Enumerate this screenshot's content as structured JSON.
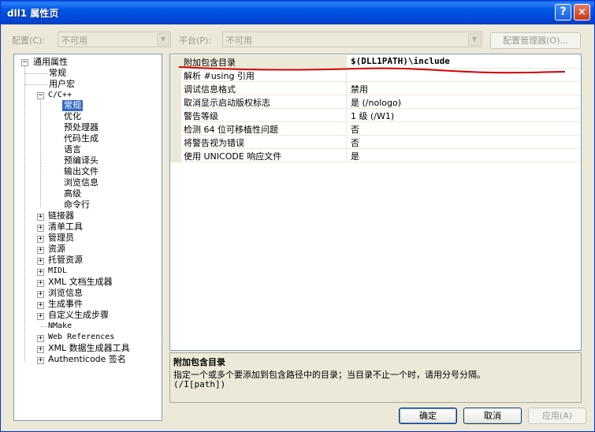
{
  "window": {
    "title": "dll1 属性页",
    "help_label": "?",
    "close_label": "×"
  },
  "config_bar": {
    "config_label": "配置(C):",
    "config_value": "不可用",
    "platform_label": "平台(P):",
    "platform_value": "不可用",
    "manager_label": "配置管理器(O)..."
  },
  "tree": {
    "root": "通用属性",
    "root_expander": "−",
    "items": [
      {
        "label": "常规"
      },
      {
        "label": "用户宏"
      },
      {
        "label": "C/C++",
        "expander": "−"
      },
      {
        "label": "常规",
        "selected": true
      },
      {
        "label": "优化"
      },
      {
        "label": "预处理器"
      },
      {
        "label": "代码生成"
      },
      {
        "label": "语言"
      },
      {
        "label": "预编译头"
      },
      {
        "label": "输出文件"
      },
      {
        "label": "浏览信息"
      },
      {
        "label": "高级"
      },
      {
        "label": "命令行"
      },
      {
        "label": "链接器",
        "expander": "+"
      },
      {
        "label": "清单工具",
        "expander": "+"
      },
      {
        "label": "管理员",
        "expander": "+"
      },
      {
        "label": "资源",
        "expander": "+"
      },
      {
        "label": "托管资源",
        "expander": "+"
      },
      {
        "label": "MIDL",
        "expander": "+"
      },
      {
        "label": "XML 文档生成器",
        "expander": "+"
      },
      {
        "label": "浏览信息",
        "expander": "+"
      },
      {
        "label": "生成事件",
        "expander": "+"
      },
      {
        "label": "自定义生成步骤",
        "expander": "+"
      },
      {
        "label": "NMake"
      },
      {
        "label": "Web References",
        "expander": "+"
      },
      {
        "label": "XML 数据生成器工具",
        "expander": "+"
      },
      {
        "label": "Authenticode 签名",
        "expander": "+"
      }
    ]
  },
  "grid": {
    "rows": [
      {
        "name": "附加包含目录",
        "value": "$(DLL1PATH)\\include"
      },
      {
        "name": "解析 #using 引用",
        "value": ""
      },
      {
        "name": "调试信息格式",
        "value": "禁用"
      },
      {
        "name": "取消显示启动版权标志",
        "value": "是 (/nologo)"
      },
      {
        "name": "警告等级",
        "value": "1 级 (/W1)"
      },
      {
        "name": "检测 64 位可移植性问题",
        "value": "否"
      },
      {
        "name": "将警告视为错误",
        "value": "否"
      },
      {
        "name": "使用 UNICODE 响应文件",
        "value": "是"
      }
    ]
  },
  "description": {
    "title": "附加包含目录",
    "body": "指定一个或多个要添加到包含路径中的目录；当目录不止一个时，请用分号分隔。",
    "switch": "(/I[path])"
  },
  "buttons": {
    "ok": "确定",
    "cancel": "取消",
    "apply": "应用(A)"
  },
  "colors": {
    "annotation_red": "#d40000",
    "selection": "#316ac5"
  }
}
